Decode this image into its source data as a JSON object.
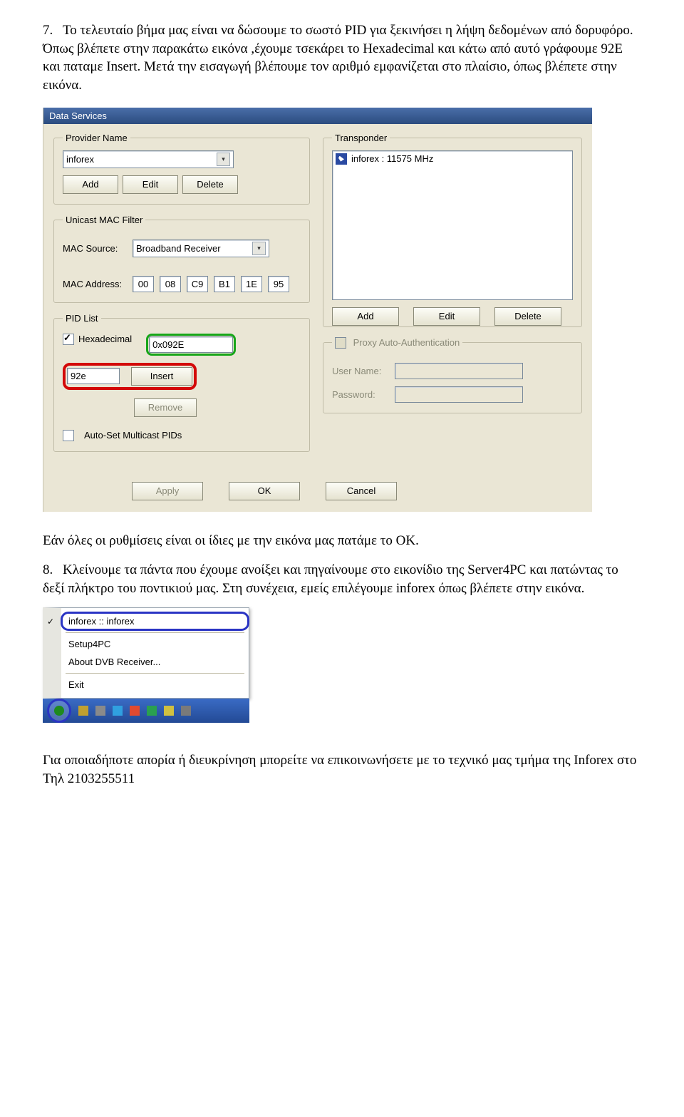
{
  "doc": {
    "item7_num": "7.",
    "item7_text": "Το τελευταίο βήμα μας είναι να δώσουμε το σωστό PID για ξεκινήσει η λήψη δεδομένων από δορυφόρο. Όπως βλέπετε στην παρακάτω εικόνα ,έχουμε τσεκάρει το Hexadecimal και κάτω από αυτό γράφουμε 92E και παταμε Insert. Μετά την εισαγωγή βλέπουμε τον αριθμό εμφανίζεται στο πλαίσιο, όπως βλέπετε στην εικόνα.",
    "mid_line": "Εάν όλες οι ρυθμίσεις είναι οι ίδιες με την εικόνα μας πατάμε το ΟΚ.",
    "item8_num": "8.",
    "item8_text": "Κλείνουμε τα πάντα που έχουμε ανοίξει και πηγαίνουμε στο εικονίδιο της Server4PC και πατώντας το δεξί πλήκτρο του ποντικιού μας. Στη συνέχεια, εμείς επιλέγουμε inforex όπως βλέπετε στην εικόνα.",
    "footer": "Για οποιαδήποτε απορία ή διευκρίνηση μπορείτε να επικοινωνήσετε με το τεχνικό μας τμήμα της Inforex στο Τηλ 2103255511"
  },
  "dialog": {
    "title": "Data Services",
    "provider": {
      "legend": "Provider Name",
      "selected": "inforex",
      "buttons": {
        "add": "Add",
        "edit": "Edit",
        "delete": "Delete"
      }
    },
    "transponder": {
      "legend": "Transponder",
      "item": "inforex : 11575 MHz",
      "buttons": {
        "add": "Add",
        "edit": "Edit",
        "delete": "Delete"
      }
    },
    "mac": {
      "legend": "Unicast MAC Filter",
      "source_label": "MAC Source:",
      "source_value": "Broadband Receiver",
      "addr_label": "MAC Address:",
      "addr": [
        "00",
        "08",
        "C9",
        "B1",
        "1E",
        "95"
      ]
    },
    "pid": {
      "legend": "PID List",
      "hex_label": "Hexadecimal",
      "list_value": "0x092E",
      "input_value": "92e",
      "insert": "Insert",
      "remove": "Remove",
      "auto_label": "Auto-Set Multicast PIDs"
    },
    "proxy": {
      "legend": "Proxy Auto-Authentication",
      "user_label": "User Name:",
      "pass_label": "Password:"
    },
    "bottom": {
      "apply": "Apply",
      "ok": "OK",
      "cancel": "Cancel"
    }
  },
  "menu": {
    "item1": "inforex :: inforex",
    "item2": "Setup4PC",
    "item3": "About DVB Receiver...",
    "item4": "Exit"
  }
}
